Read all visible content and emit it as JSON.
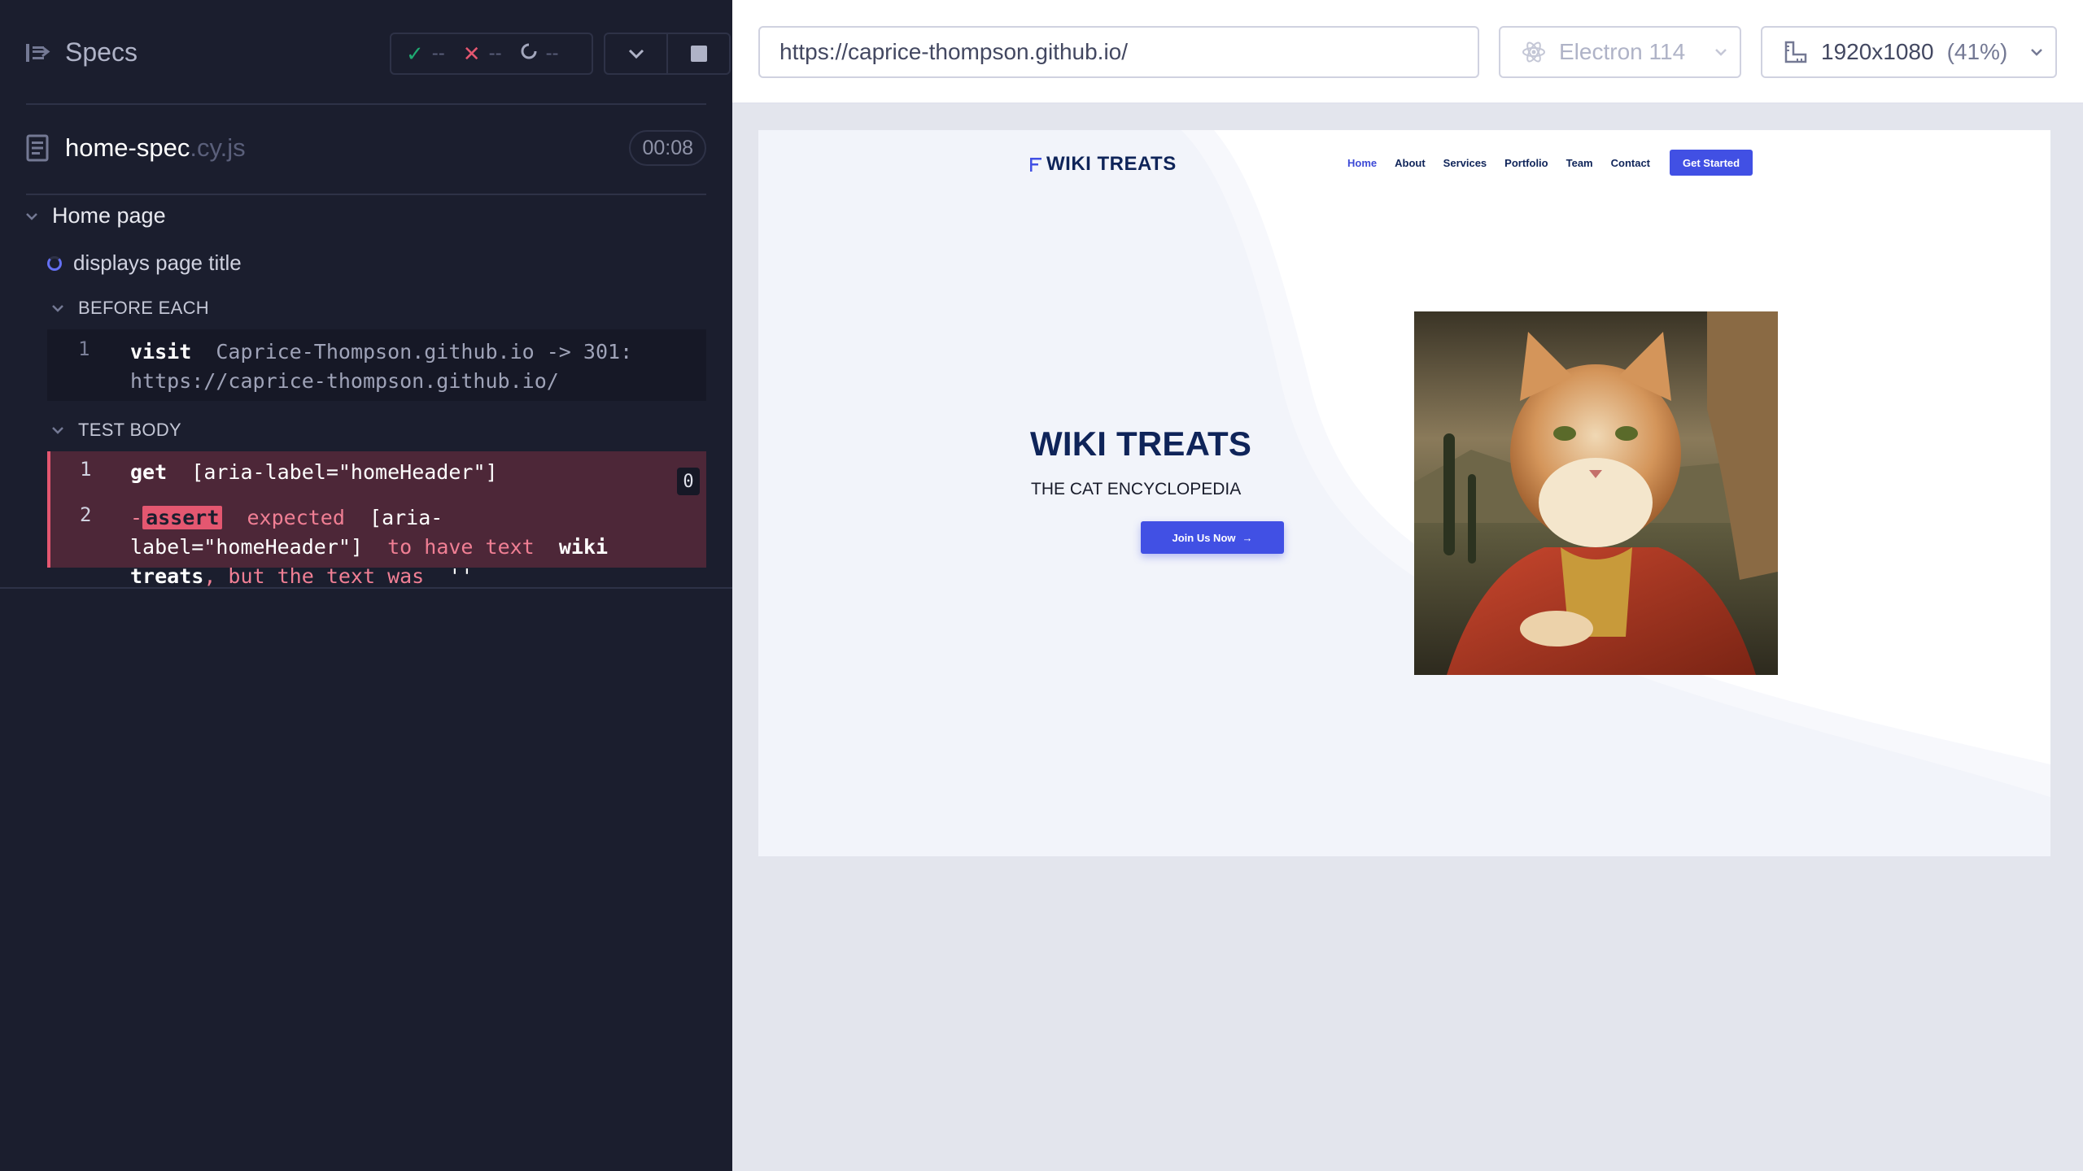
{
  "reporter": {
    "specs_label": "Specs",
    "stats": {
      "passed": "--",
      "failed": "--",
      "pending": "--"
    },
    "file": {
      "name": "home-spec",
      "ext": ".cy.js",
      "duration": "00:08"
    },
    "suite_title": "Home page",
    "test_title": "displays page title",
    "before_each": {
      "title": "BEFORE EACH",
      "commands": [
        {
          "num": "1",
          "name": "visit",
          "message": "Caprice-Thompson.github.io -> 301: https://caprice-thompson.github.io/"
        }
      ]
    },
    "test_body": {
      "title": "TEST BODY",
      "commands": [
        {
          "num": "1",
          "name": "get",
          "message": "[aria-label=\"homeHeader\"]",
          "count": "0"
        },
        {
          "num": "2",
          "prefix": "-",
          "name": "assert",
          "expected": "expected",
          "selector": "[aria-label=\"homeHeader\"]",
          "to": "to",
          "have_text": "have text",
          "value": "wiki treats",
          "but": ", but the text was",
          "actual": "''"
        }
      ]
    }
  },
  "toolbar": {
    "url": "https://caprice-thompson.github.io/",
    "browser": "Electron 114",
    "viewport": "1920x1080",
    "zoom": "(41%)"
  },
  "site": {
    "logo": "WIKI TREATS",
    "nav": [
      "Home",
      "About",
      "Services",
      "Portfolio",
      "Team",
      "Contact"
    ],
    "cta": "Get Started",
    "hero_title": "WIKI TREATS",
    "hero_subtitle": "THE CAT ENCYCLOPEDIA",
    "join_button": "Join Us Now",
    "colors": {
      "brand": "#0f2459",
      "accent": "#4150e4"
    }
  },
  "colors": {
    "pass": "#1fa971",
    "fail": "#e45770",
    "reporter_bg": "#1b1e2e"
  }
}
